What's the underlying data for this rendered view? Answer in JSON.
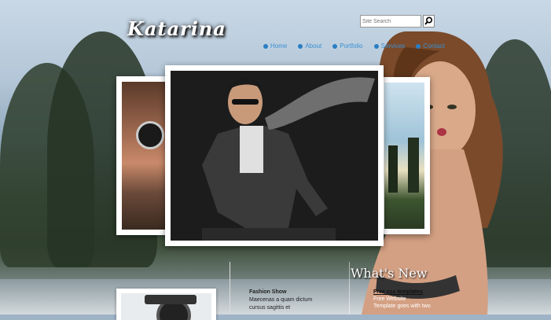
{
  "header": {
    "logo_text": "Katarina",
    "search_placeholder": "Site Search"
  },
  "nav": {
    "items": [
      {
        "label": "Home"
      },
      {
        "label": "About"
      },
      {
        "label": "Portfolio"
      },
      {
        "label": "Services"
      },
      {
        "label": "Contact"
      }
    ]
  },
  "gallery": {
    "left_image": "portrait-photo",
    "main_image": "man-in-jacket-photo",
    "right_image": "sunset-trees-photo"
  },
  "news": {
    "item_title": "Fashion Show",
    "item_text_1": "Maecenas a quam dictum",
    "item_text_2": "cursus sagittis et"
  },
  "whats_new": {
    "title": "What's New",
    "link": "Free css templates",
    "line1": "Free Website",
    "line2": "Template goes with two"
  },
  "colors": {
    "nav_link": "#3b8fd0",
    "logo": "#ffffff"
  }
}
